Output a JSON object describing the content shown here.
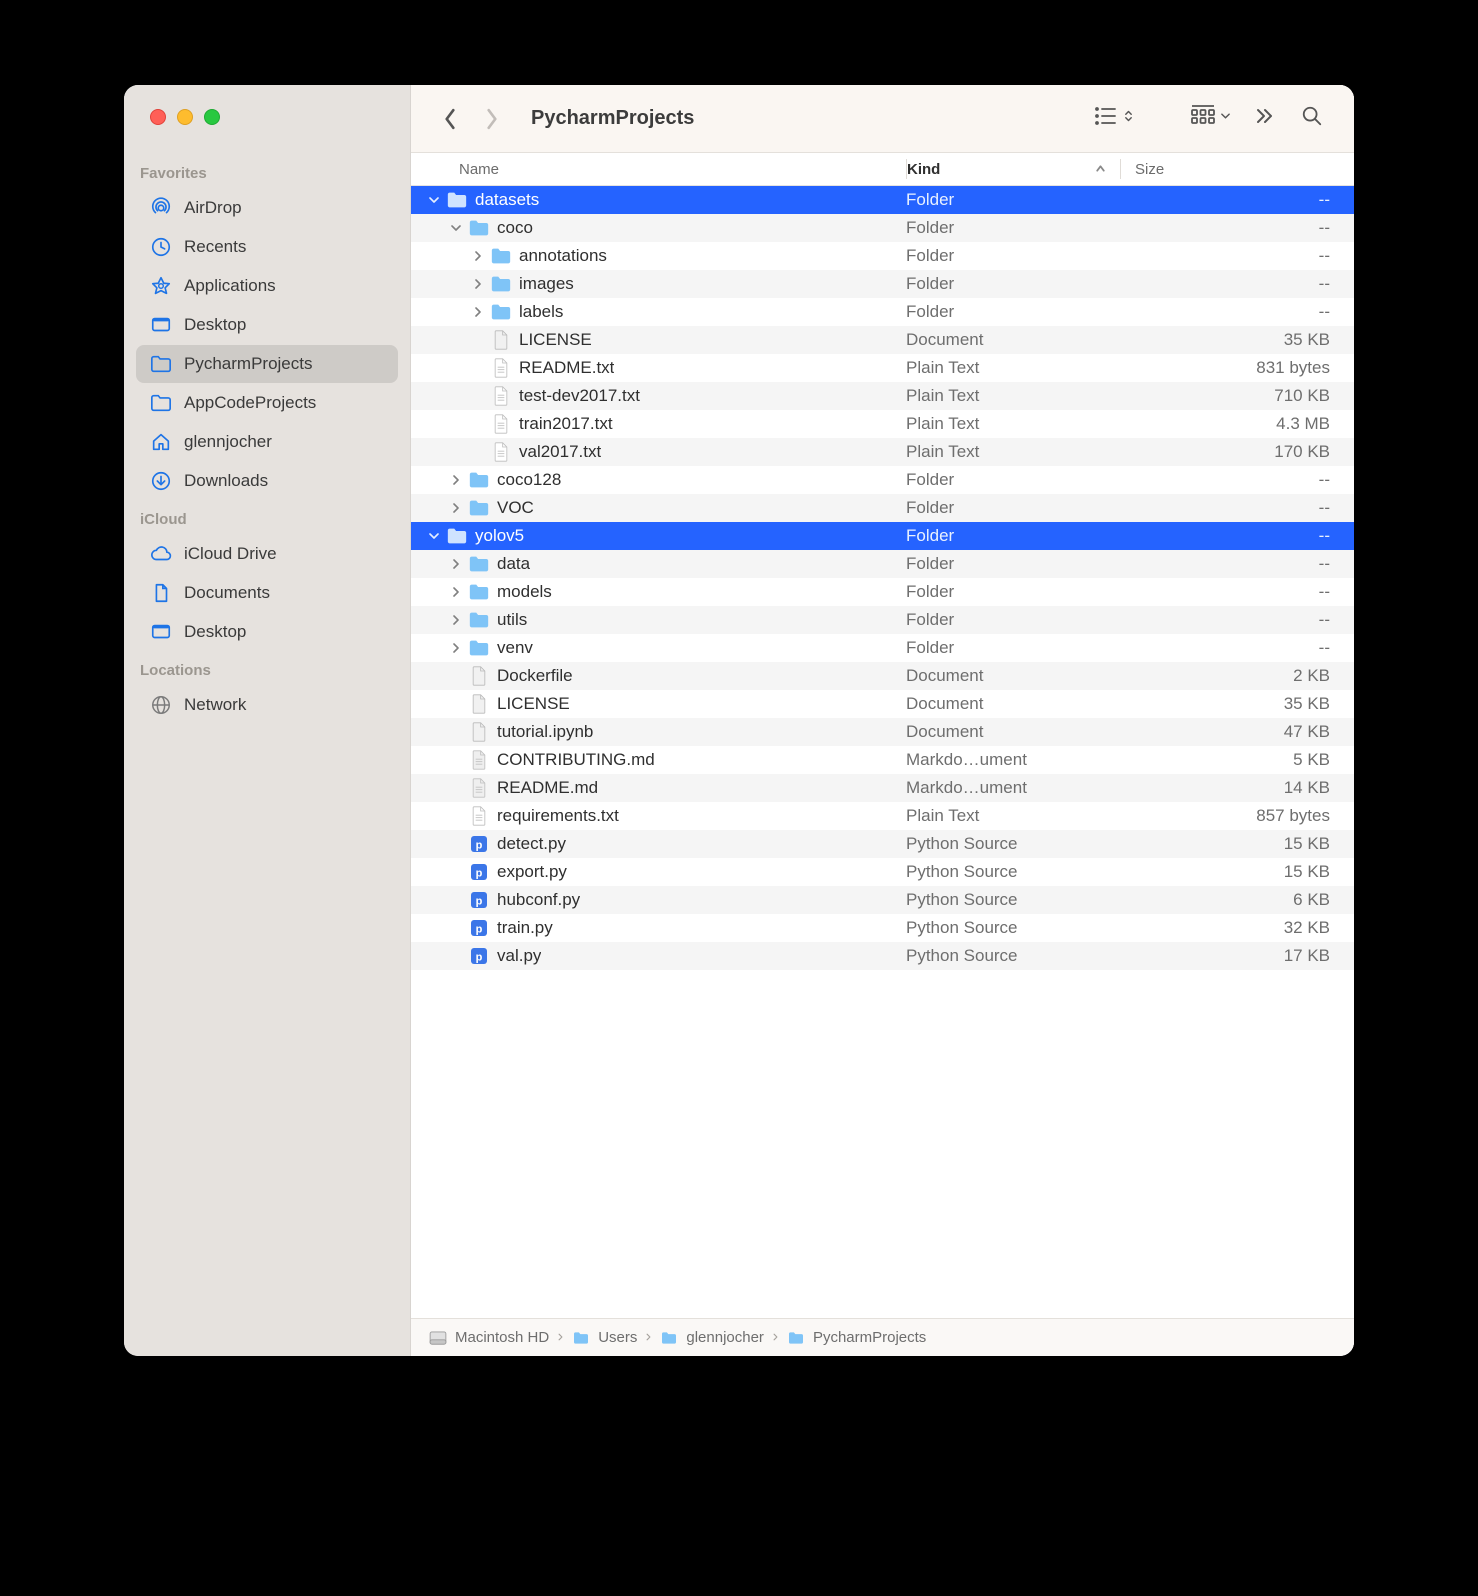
{
  "title": "PycharmProjects",
  "columns": {
    "name": "Name",
    "kind": "Kind",
    "size": "Size"
  },
  "sidebar": {
    "sections": [
      {
        "label": "Favorites",
        "items": [
          {
            "icon": "airdrop",
            "label": "AirDrop"
          },
          {
            "icon": "clock",
            "label": "Recents"
          },
          {
            "icon": "apps",
            "label": "Applications"
          },
          {
            "icon": "desktop",
            "label": "Desktop"
          },
          {
            "icon": "folder",
            "label": "PycharmProjects",
            "selected": true
          },
          {
            "icon": "folder",
            "label": "AppCodeProjects"
          },
          {
            "icon": "home",
            "label": "glennjocher"
          },
          {
            "icon": "download",
            "label": "Downloads"
          }
        ]
      },
      {
        "label": "iCloud",
        "items": [
          {
            "icon": "cloud",
            "label": "iCloud Drive"
          },
          {
            "icon": "docs",
            "label": "Documents"
          },
          {
            "icon": "desktop",
            "label": "Desktop"
          }
        ]
      },
      {
        "label": "Locations",
        "items": [
          {
            "icon": "network",
            "label": "Network",
            "grey": true
          }
        ]
      }
    ]
  },
  "rows": [
    {
      "indent": 0,
      "disc": "down",
      "icon": "folder",
      "name": "datasets",
      "kind": "Folder",
      "size": "--",
      "selected": true
    },
    {
      "indent": 1,
      "disc": "down",
      "icon": "folder",
      "name": "coco",
      "kind": "Folder",
      "size": "--"
    },
    {
      "indent": 2,
      "disc": "right",
      "icon": "folder",
      "name": "annotations",
      "kind": "Folder",
      "size": "--"
    },
    {
      "indent": 2,
      "disc": "right",
      "icon": "folder",
      "name": "images",
      "kind": "Folder",
      "size": "--"
    },
    {
      "indent": 2,
      "disc": "right",
      "icon": "folder",
      "name": "labels",
      "kind": "Folder",
      "size": "--"
    },
    {
      "indent": 2,
      "disc": "",
      "icon": "doc",
      "name": "LICENSE",
      "kind": "Document",
      "size": "35 KB"
    },
    {
      "indent": 2,
      "disc": "",
      "icon": "txt",
      "name": "README.txt",
      "kind": "Plain Text",
      "size": "831 bytes"
    },
    {
      "indent": 2,
      "disc": "",
      "icon": "txt",
      "name": "test-dev2017.txt",
      "kind": "Plain Text",
      "size": "710 KB"
    },
    {
      "indent": 2,
      "disc": "",
      "icon": "txt",
      "name": "train2017.txt",
      "kind": "Plain Text",
      "size": "4.3 MB"
    },
    {
      "indent": 2,
      "disc": "",
      "icon": "txt",
      "name": "val2017.txt",
      "kind": "Plain Text",
      "size": "170 KB"
    },
    {
      "indent": 1,
      "disc": "right",
      "icon": "folder",
      "name": "coco128",
      "kind": "Folder",
      "size": "--"
    },
    {
      "indent": 1,
      "disc": "right",
      "icon": "folder",
      "name": "VOC",
      "kind": "Folder",
      "size": "--"
    },
    {
      "indent": 0,
      "disc": "down",
      "icon": "folder",
      "name": "yolov5",
      "kind": "Folder",
      "size": "--",
      "selected": true
    },
    {
      "indent": 1,
      "disc": "right",
      "icon": "folder",
      "name": "data",
      "kind": "Folder",
      "size": "--"
    },
    {
      "indent": 1,
      "disc": "right",
      "icon": "folder",
      "name": "models",
      "kind": "Folder",
      "size": "--"
    },
    {
      "indent": 1,
      "disc": "right",
      "icon": "folder",
      "name": "utils",
      "kind": "Folder",
      "size": "--"
    },
    {
      "indent": 1,
      "disc": "right",
      "icon": "folder",
      "name": "venv",
      "kind": "Folder",
      "size": "--"
    },
    {
      "indent": 1,
      "disc": "",
      "icon": "doc",
      "name": "Dockerfile",
      "kind": "Document",
      "size": "2 KB"
    },
    {
      "indent": 1,
      "disc": "",
      "icon": "doc",
      "name": "LICENSE",
      "kind": "Document",
      "size": "35 KB"
    },
    {
      "indent": 1,
      "disc": "",
      "icon": "doc",
      "name": "tutorial.ipynb",
      "kind": "Document",
      "size": "47 KB"
    },
    {
      "indent": 1,
      "disc": "",
      "icon": "md",
      "name": "CONTRIBUTING.md",
      "kind": "Markdo…ument",
      "size": "5 KB"
    },
    {
      "indent": 1,
      "disc": "",
      "icon": "md",
      "name": "README.md",
      "kind": "Markdo…ument",
      "size": "14 KB"
    },
    {
      "indent": 1,
      "disc": "",
      "icon": "txt",
      "name": "requirements.txt",
      "kind": "Plain Text",
      "size": "857 bytes"
    },
    {
      "indent": 1,
      "disc": "",
      "icon": "py",
      "name": "detect.py",
      "kind": "Python Source",
      "size": "15 KB"
    },
    {
      "indent": 1,
      "disc": "",
      "icon": "py",
      "name": "export.py",
      "kind": "Python Source",
      "size": "15 KB"
    },
    {
      "indent": 1,
      "disc": "",
      "icon": "py",
      "name": "hubconf.py",
      "kind": "Python Source",
      "size": "6 KB"
    },
    {
      "indent": 1,
      "disc": "",
      "icon": "py",
      "name": "train.py",
      "kind": "Python Source",
      "size": "32 KB"
    },
    {
      "indent": 1,
      "disc": "",
      "icon": "py",
      "name": "val.py",
      "kind": "Python Source",
      "size": "17 KB"
    }
  ],
  "path": [
    {
      "icon": "drive",
      "label": "Macintosh HD"
    },
    {
      "icon": "folder",
      "label": "Users"
    },
    {
      "icon": "folder",
      "label": "glennjocher"
    },
    {
      "icon": "folder",
      "label": "PycharmProjects"
    }
  ]
}
